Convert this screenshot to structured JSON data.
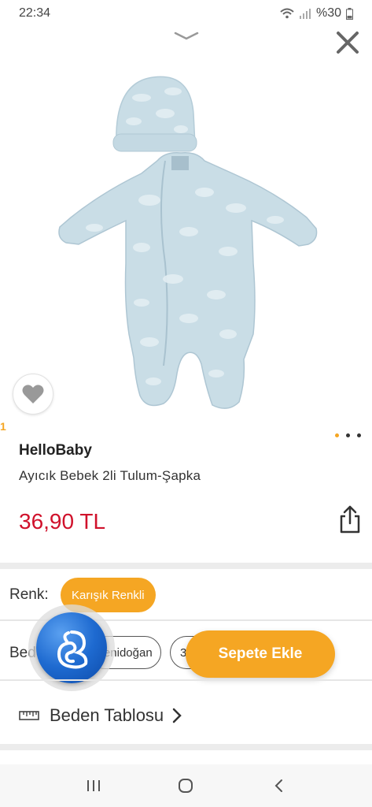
{
  "status_bar": {
    "time": "22:34",
    "battery": "%30"
  },
  "product": {
    "image_index": "1",
    "brand": "HelloBaby",
    "name": "Ayıcık Bebek 2li Tulum-Şapka",
    "price": "36,90 TL",
    "image_count": 3,
    "active_image": 0
  },
  "options": {
    "color_label": "Renk:",
    "color_value": "Karışık Renkli",
    "size_label": "Beden:",
    "size_values": [
      "Yenidoğan",
      "3"
    ]
  },
  "actions": {
    "add_to_cart": "Sepete Ekle"
  },
  "size_table": {
    "label": "Beden Tablosu"
  },
  "colors": {
    "accent": "#f5a623",
    "price": "#d0112b",
    "garment": "#c9dde6"
  },
  "icons": [
    "chevron-down-icon",
    "close-icon",
    "heart-icon",
    "share-icon",
    "ruler-icon",
    "chevron-right-icon",
    "recent-apps-icon",
    "home-icon",
    "back-icon"
  ]
}
